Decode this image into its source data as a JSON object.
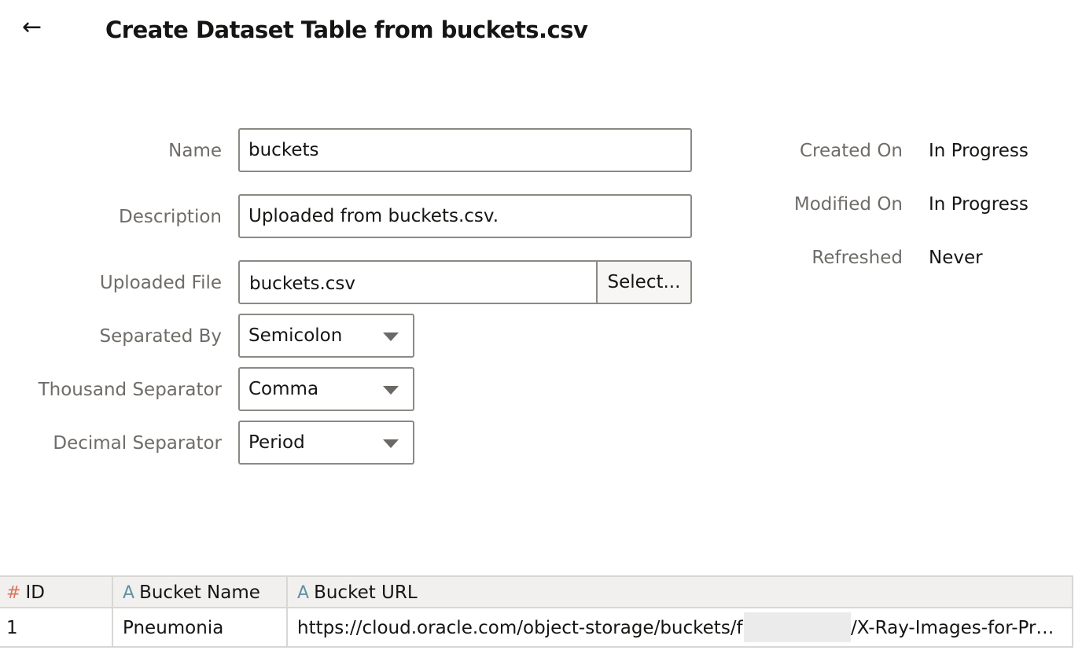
{
  "header": {
    "back_icon": "←",
    "title": "Create Dataset Table from buckets.csv"
  },
  "form": {
    "name_label": "Name",
    "name_value": "buckets",
    "description_label": "Description",
    "description_value": "Uploaded from buckets.csv.",
    "uploaded_file_label": "Uploaded File",
    "uploaded_file_value": "buckets.csv",
    "select_button_label": "Select...",
    "separated_by_label": "Separated By",
    "separated_by_value": "Semicolon",
    "thousand_separator_label": "Thousand Separator",
    "thousand_separator_value": "Comma",
    "decimal_separator_label": "Decimal Separator",
    "decimal_separator_value": "Period"
  },
  "meta": {
    "created_on_label": "Created On",
    "created_on_value": "In Progress",
    "modified_on_label": "Modified On",
    "modified_on_value": "In Progress",
    "refreshed_label": "Refreshed",
    "refreshed_value": "Never"
  },
  "grid": {
    "columns": [
      {
        "type_icon": "#",
        "label": "ID"
      },
      {
        "type_icon": "A",
        "label": "Bucket Name"
      },
      {
        "type_icon": "A",
        "label": "Bucket URL"
      }
    ],
    "rows": [
      {
        "id": "1",
        "bucket_name": "Pneumonia",
        "bucket_url_prefix": "https://cloud.oracle.com/object-storage/buckets/f",
        "bucket_url_suffix": "/X-Ray-Images-for-Pr…"
      }
    ]
  },
  "colors": {
    "number_type": "#d9745f",
    "text_type": "#5f92a3",
    "border": "#8c8984",
    "label": "#6f6c68"
  }
}
